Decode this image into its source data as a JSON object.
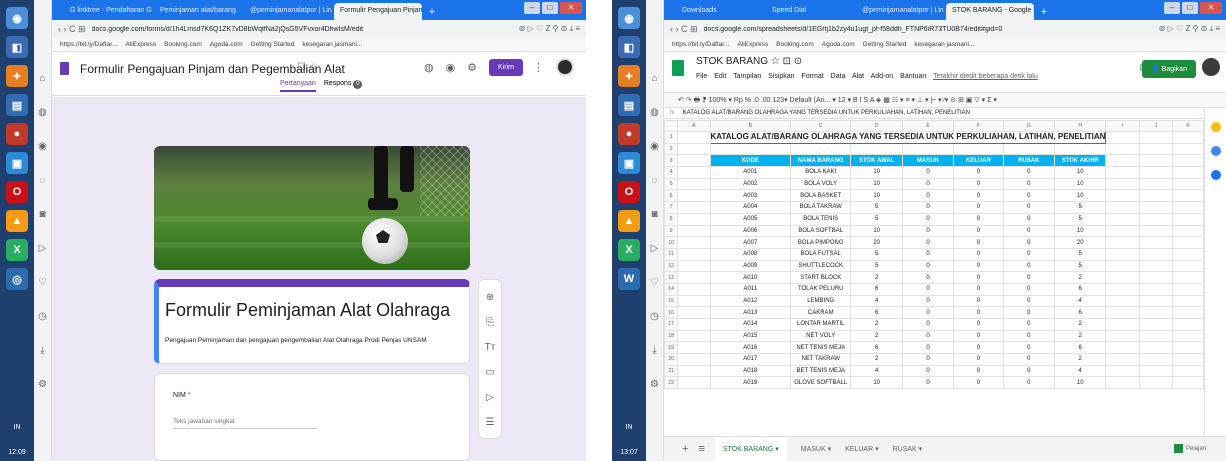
{
  "left": {
    "tabs": [
      "G linktree - Pendaftaran Gc",
      "Peminjaman alat/barang",
      "@peminjamanalatpor | Lin",
      "Formulir Pengajuan Pinjam"
    ],
    "url_prefix": "docs.google.com",
    "url_rest": "/forms/d/1h4Lmsd7K6Q1ZK7vD8bWqtfNa2jQsG5VFvxor4DhwIsM/edit",
    "bookmarks": [
      "https://bit.ly/Daftar...",
      "AliExpress",
      "Booking.com",
      "Agoda.com",
      "Getting Started",
      "kesegaran jasmani..."
    ],
    "form_title": "Formulir Pengajuan Pinjam dan Pegembalian Alat",
    "send_label": "Kirim",
    "tab_questions": "Pertanyaan",
    "tab_responses": "Respons",
    "responses_count": "0",
    "card_title": "Formulir Peminjaman Alat Olahraga",
    "card_desc": "Pengajuan Peminjaman dan pengajuan pengembalian Alat Olahraga Prodi Penjas UNSAM",
    "nim_label": "NIM",
    "nim_required": "*",
    "nim_placeholder": "Teks jawaban singkat",
    "tools": [
      "⊕",
      "⎘",
      "Tт",
      "▭",
      "▷",
      "☰"
    ]
  },
  "right": {
    "tabs": [
      "Downloads",
      "Speed Dial",
      "@peminjamanalatpor | Lin",
      "STOK BARANG - Google S"
    ],
    "url_prefix": "docs.google.com",
    "url_rest": "/spreadsheets/d/1EGrtj1b2zy4u1ugt_pf-f58ddh_FTNP6iR73TU0B74/edit#gid=0",
    "bookmarks": [
      "https://bit.ly/Daftar...",
      "AliExpress",
      "Booking.com",
      "Agoda.com",
      "Getting Started",
      "kesegaran jasmani..."
    ],
    "sheet_title": "STOK BARANG",
    "menu": [
      "File",
      "Edit",
      "Tampilan",
      "Sisipkan",
      "Format",
      "Data",
      "Alat",
      "Add-on",
      "Bantuan"
    ],
    "last_edit": "Terakhir diedit beberapa detik lalu",
    "share_label": "Bagikan",
    "toolbar": "↶ ↷ 🖶 ⁋   100% ▾   Rp  %  .0  .00  123▾   Default (Ari... ▾   12 ▾   B  I  S  A   ◈  ▦  ☷ ▾   ≡ ▾  ⊥ ▾  |÷ ▾  ⁄▾   ⊝  ⊞  ▣  ▽ ▾  Σ ▾",
    "fx_label": "fx",
    "formula": "KATALOG ALAT/BARANG OLAHRAGA YANG TERSEDIA UNTUK PERKULIAHAN, LATIHAN, PENELITIAN",
    "columns": [
      "A",
      "B",
      "C",
      "D",
      "E",
      "F",
      "G",
      "H",
      "I",
      "J",
      "K"
    ],
    "catalog_title": "KATALOG ALAT/BARANG OLAHRAGA YANG TERSEDIA UNTUK PERKULIAHAN, LATIHAN, PENELITIAN",
    "headers": [
      "KODE",
      "NAMA BARANG",
      "STOK AWAL",
      "MASUK",
      "KELUAR",
      "RUSAK",
      "STOK AKHIR"
    ],
    "rows": [
      [
        "A001",
        "BOLA KAKI",
        "10",
        "0",
        "0",
        "0",
        "10"
      ],
      [
        "A002",
        "BOLA VOLY",
        "10",
        "0",
        "0",
        "0",
        "10"
      ],
      [
        "A003",
        "BOLA BASKET",
        "10",
        "0",
        "0",
        "0",
        "10"
      ],
      [
        "A004",
        "BOLA TAKRAW",
        "5",
        "0",
        "0",
        "0",
        "5"
      ],
      [
        "A005",
        "BOLA TENIS",
        "5",
        "0",
        "0",
        "0",
        "5"
      ],
      [
        "A006",
        "BOLA SOFTBAL",
        "10",
        "0",
        "0",
        "0",
        "10"
      ],
      [
        "A007",
        "BOLA PIMPONG",
        "20",
        "0",
        "0",
        "0",
        "20"
      ],
      [
        "A008",
        "BOLA FUTSAL",
        "5",
        "0",
        "0",
        "0",
        "5"
      ],
      [
        "A009",
        "SHUTTLECOCK",
        "5",
        "0",
        "0",
        "0",
        "5"
      ],
      [
        "A010",
        "START BLOCK",
        "2",
        "0",
        "0",
        "0",
        "2"
      ],
      [
        "A011",
        "TOLAK PELURU",
        "6",
        "0",
        "0",
        "0",
        "6"
      ],
      [
        "A012",
        "LEMBING",
        "4",
        "0",
        "0",
        "0",
        "4"
      ],
      [
        "A013",
        "CAKRAM",
        "6",
        "0",
        "0",
        "0",
        "6"
      ],
      [
        "A014",
        "LONTAR MARTIL",
        "2",
        "0",
        "0",
        "0",
        "2"
      ],
      [
        "A015",
        "NET VOLY",
        "2",
        "0",
        "0",
        "0",
        "2"
      ],
      [
        "A016",
        "NET TENIS MEJA",
        "6",
        "0",
        "0",
        "0",
        "6"
      ],
      [
        "A017",
        "NET TAKRAW",
        "2",
        "0",
        "0",
        "0",
        "2"
      ],
      [
        "A018",
        "BET TENIS MEJA",
        "4",
        "0",
        "0",
        "0",
        "4"
      ],
      [
        "A019",
        "GLOVE SOFTBALL",
        "10",
        "0",
        "0",
        "0",
        "10"
      ]
    ],
    "sheet_tabs": [
      "STOK BARANG ▾",
      "MASUK ▾",
      "KELUAR ▾",
      "RUSAK ▾"
    ],
    "explore_label": "Pelajari"
  },
  "taskbar": {
    "lang": "IN",
    "time": "12:09",
    "time_r": "13:07"
  },
  "colors": {
    "accent_forms": "#673ab7",
    "accent_sheets": "#1e8e3e",
    "header_cell": "#00b0f0",
    "tabbar": "#1a73e8"
  }
}
